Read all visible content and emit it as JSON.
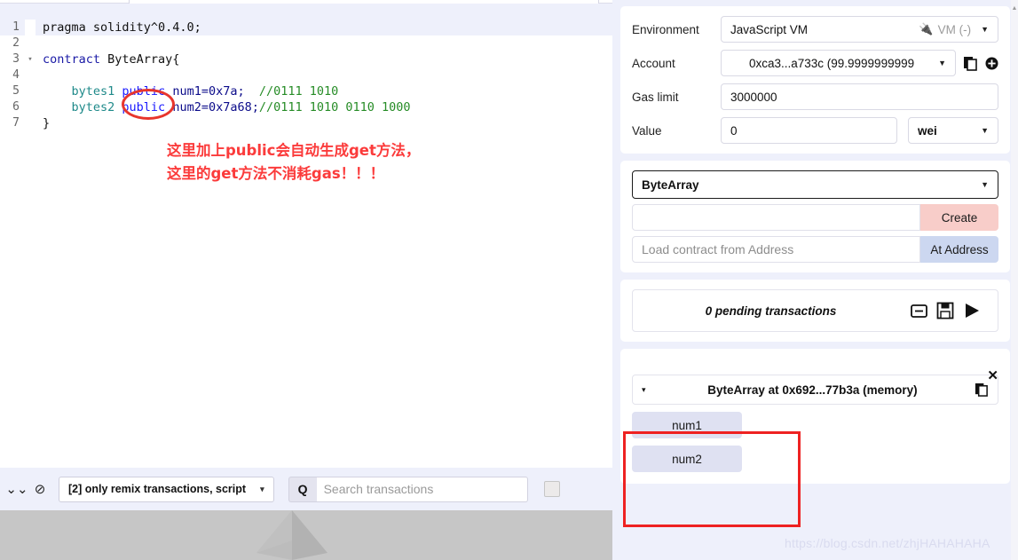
{
  "editor": {
    "lines": [
      {
        "no": "1",
        "fold": "",
        "active": true,
        "segments": [
          {
            "t": "pragma solidity^0.4.0;",
            "c": "k-cls"
          }
        ]
      },
      {
        "no": "2",
        "fold": "",
        "active": false,
        "segments": [
          {
            "t": "",
            "c": "k-cls"
          }
        ]
      },
      {
        "no": "3",
        "fold": "▾",
        "active": false,
        "segments": [
          {
            "t": "contract ",
            "c": "k-kw"
          },
          {
            "t": "ByteArray{",
            "c": "k-cls"
          }
        ]
      },
      {
        "no": "4",
        "fold": "",
        "active": false,
        "segments": [
          {
            "t": "",
            "c": "k-cls"
          }
        ]
      },
      {
        "no": "5",
        "fold": "",
        "active": false,
        "segments": [
          {
            "t": "    ",
            "c": "k-cls"
          },
          {
            "t": "bytes1 ",
            "c": "k-type"
          },
          {
            "t": "public ",
            "c": "k-mod"
          },
          {
            "t": "num1=0x7a;  ",
            "c": "k-num"
          },
          {
            "t": "//0111 1010",
            "c": "k-com"
          }
        ]
      },
      {
        "no": "6",
        "fold": "",
        "active": false,
        "segments": [
          {
            "t": "    ",
            "c": "k-cls"
          },
          {
            "t": "bytes2 ",
            "c": "k-type"
          },
          {
            "t": "public ",
            "c": "k-mod"
          },
          {
            "t": "num2=0x7a68;",
            "c": "k-num"
          },
          {
            "t": "//0111 1010 0110 1000",
            "c": "k-com"
          }
        ]
      },
      {
        "no": "7",
        "fold": "",
        "active": false,
        "segments": [
          {
            "t": "}",
            "c": "k-cls"
          }
        ]
      }
    ],
    "annotation_line1": "这里加上public会自动生成get方法，",
    "annotation_line2": "这里的get方法不消耗gas！！！",
    "annotation_color": "#fb3b3b",
    "highlight_circle_color": "#e8352c"
  },
  "bottom_toolbar": {
    "collapse_icon": "chevron-double-down-icon",
    "clear_icon": "ban-icon",
    "filter_label": "[2] only remix transactions, script",
    "filter_caret": "▾",
    "search_icon_glyph": "Q",
    "search_placeholder": "Search transactions"
  },
  "right_panel": {
    "settings": {
      "environment_label": "Environment",
      "environment_value": "JavaScript VM",
      "environment_status": "VM (-)",
      "environment_status_icon": "plug-icon",
      "account_label": "Account",
      "account_value": "0xca3...a733c (99.9999999999",
      "account_copy_icon": "copy-icon",
      "account_add_icon": "plus-circle-icon",
      "gas_label": "Gas limit",
      "gas_value": "3000000",
      "value_label": "Value",
      "value_value": "0",
      "value_unit": "wei"
    },
    "deploy": {
      "contract_name": "ByteArray",
      "constructor_value": "",
      "create_label": "Create",
      "at_address_placeholder": "Load contract from Address",
      "at_address_label": "At Address"
    },
    "pending": {
      "text": "0 pending transactions",
      "minus_icon": "minus-box-icon",
      "save_icon": "floppy-disk-icon",
      "play_icon": "play-icon"
    },
    "deployed": {
      "close_label": "✕",
      "caret": "▾",
      "title": "ByteArray at 0x692...77b3a (memory)",
      "copy_icon": "copy-icon",
      "functions": [
        {
          "label": "num1"
        },
        {
          "label": "num2"
        }
      ],
      "highlight_color": "#ee2222"
    }
  },
  "watermark": "https://blog.csdn.net/zhjHAHAHAHA",
  "colors": {
    "panel_bg": "#eef0fb",
    "create_btn": "#f8cdc9",
    "at_address_btn": "#ccd7f0",
    "fn_btn": "#dfe1f2"
  }
}
